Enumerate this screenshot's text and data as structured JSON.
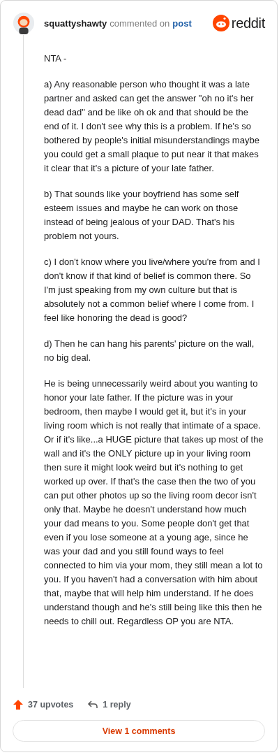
{
  "header": {
    "username": "squattyshawty",
    "action": "commented on",
    "link": "post",
    "brand": "reddit"
  },
  "comment": {
    "paragraphs": [
      "NTA -",
      "a) Any reasonable person who thought it was a late partner and asked can get the answer \"oh no it's her dead dad\" and be like oh ok and that should be the end of it. I don't see why this is a problem. If he's so bothered by people's initial misunderstandings maybe you could get a small plaque to put near it that makes it clear that it's a picture of your late father.",
      "b) That sounds like your boyfriend has some self esteem issues and maybe he can work on those instead of being jealous of your DAD. That's his problem not yours.",
      "c) I don't know where you live/where you're from and I don't know if that kind of belief is common there. So I'm just speaking from my own culture but that is absolutely not a common belief where I come from. I feel like honoring the dead is good?",
      "d) Then he can hang his parents' picture on the wall, no big deal.",
      "He is being unnecessarily weird about you wanting to honor your late father. If the picture was in your bedroom, then maybe I would get it, but it's in your living room which is not really that intimate of a space. Or if it's like...a HUGE picture that takes up most of the wall and it's the ONLY picture up in your living room then sure it might look weird but it's nothing to get worked up over. If that's the case then the two of you can put other photos up so the living room decor isn't only that. Maybe he doesn't understand how much your dad means to you. Some people don't get that even if you lose someone at a young age, since he was your dad and you still found ways to feel connected to him via your mom, they still mean a lot to you. If you haven't had a conversation with him about that, maybe that will help him understand. If he does understand though and he's still being like this then he needs to chill out. Regardless OP you are NTA."
    ]
  },
  "footer": {
    "upvotes": "37 upvotes",
    "upvoted": true,
    "replies": "1 reply",
    "view_button": "View 1 comments"
  }
}
